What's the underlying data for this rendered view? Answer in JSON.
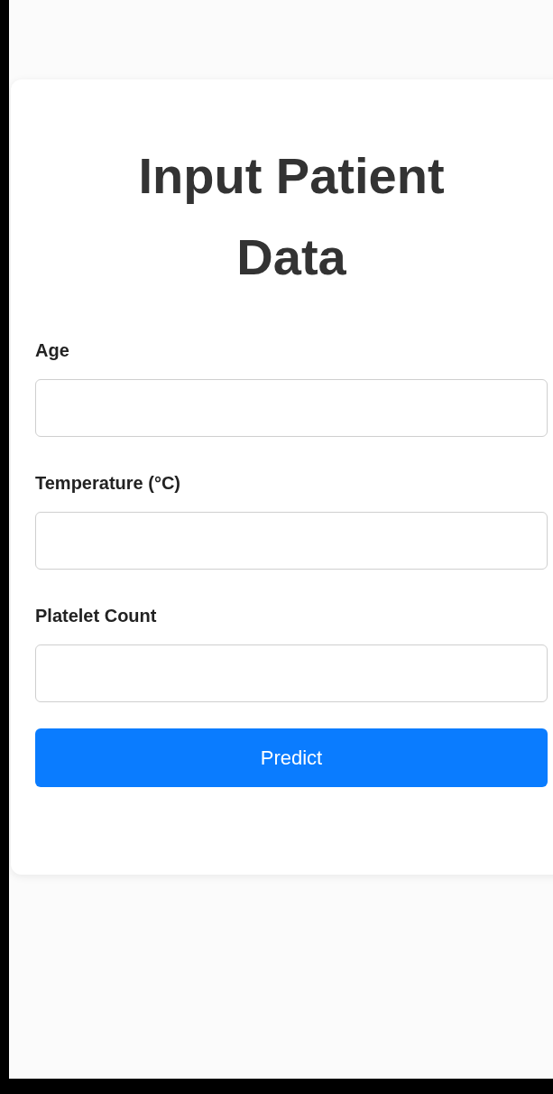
{
  "form": {
    "title": "Input Patient Data",
    "fields": [
      {
        "label": "Age"
      },
      {
        "label": "Temperature (°C)"
      },
      {
        "label": "Platelet Count"
      }
    ],
    "submit": "Predict"
  }
}
